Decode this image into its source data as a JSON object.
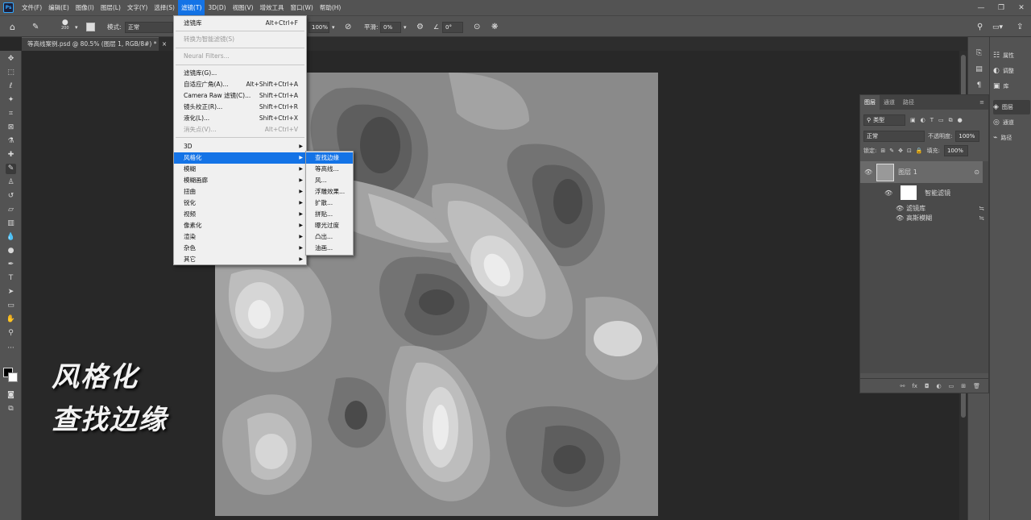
{
  "menubar": {
    "items": [
      "文件(F)",
      "编辑(E)",
      "图像(I)",
      "图层(L)",
      "文字(Y)",
      "选择(S)",
      "滤镜(T)",
      "3D(D)",
      "视图(V)",
      "增效工具",
      "窗口(W)",
      "帮助(H)"
    ],
    "active_index": 6,
    "app_icon": "Ps"
  },
  "options": {
    "brush_size": "200",
    "mode_label": "模式:",
    "mode_value": "正常",
    "opacity_value": "100%",
    "smooth_label": "平滑:",
    "smooth_value": "0%",
    "angle_value": "0°"
  },
  "document": {
    "tab_title": "等高线案例.psd @ 80.5% (图层 1, RGB/8#) *",
    "close_glyph": "×"
  },
  "filter_menu": {
    "items": [
      {
        "label": "滤镜库",
        "shortcut": "Alt+Ctrl+F",
        "disabled": false
      },
      {
        "label": "转换为智能滤镜(S)",
        "shortcut": "",
        "disabled": true
      },
      {
        "label": "Neural Filters...",
        "shortcut": "",
        "disabled": true
      },
      {
        "label": "滤镜库(G)...",
        "shortcut": "",
        "disabled": false
      },
      {
        "label": "自适应广角(A)...",
        "shortcut": "Alt+Shift+Ctrl+A",
        "disabled": false
      },
      {
        "label": "Camera Raw 滤镜(C)...",
        "shortcut": "Shift+Ctrl+A",
        "disabled": false
      },
      {
        "label": "镜头校正(R)...",
        "shortcut": "Shift+Ctrl+R",
        "disabled": false
      },
      {
        "label": "液化(L)...",
        "shortcut": "Shift+Ctrl+X",
        "disabled": false
      },
      {
        "label": "消失点(V)...",
        "shortcut": "Alt+Ctrl+V",
        "disabled": true
      },
      {
        "label": "3D",
        "shortcut": "",
        "disabled": false
      },
      {
        "label": "风格化",
        "shortcut": "",
        "disabled": false
      },
      {
        "label": "模糊",
        "shortcut": "",
        "disabled": false
      },
      {
        "label": "模糊画廊",
        "shortcut": "",
        "disabled": false
      },
      {
        "label": "扭曲",
        "shortcut": "",
        "disabled": false
      },
      {
        "label": "锐化",
        "shortcut": "",
        "disabled": false
      },
      {
        "label": "视频",
        "shortcut": "",
        "disabled": false
      },
      {
        "label": "像素化",
        "shortcut": "",
        "disabled": false
      },
      {
        "label": "渲染",
        "shortcut": "",
        "disabled": false
      },
      {
        "label": "杂色",
        "shortcut": "",
        "disabled": false
      },
      {
        "label": "其它",
        "shortcut": "",
        "disabled": false
      }
    ],
    "highlighted": "风格化"
  },
  "stylize_submenu": {
    "items": [
      "查找边缘",
      "等高线...",
      "风...",
      "浮雕效果...",
      "扩散...",
      "拼贴...",
      "曝光过度",
      "凸出...",
      "油画..."
    ],
    "highlighted": "查找边缘"
  },
  "layers_panel": {
    "tabs": [
      "图层",
      "通道",
      "路径"
    ],
    "filter_label": "类型",
    "blend_mode": "正常",
    "opacity_label": "不透明度:",
    "opacity_value": "100%",
    "lock_label": "锁定:",
    "fill_label": "填充:",
    "fill_value": "100%",
    "layer_name": "图层 1",
    "smart_filters_label": "智能滤镜",
    "filters": [
      "滤镜库",
      "高斯模糊"
    ]
  },
  "right_panels": {
    "items": [
      {
        "icon": "properties-icon",
        "label": "属性"
      },
      {
        "icon": "adjustments-icon",
        "label": "调整"
      },
      {
        "icon": "libraries-icon",
        "label": "库"
      },
      {
        "icon": "layers-icon",
        "label": "图层"
      },
      {
        "icon": "channels-icon",
        "label": "通道"
      },
      {
        "icon": "paths-icon",
        "label": "路径"
      }
    ]
  },
  "captions": {
    "line1": "风格化",
    "line2": "查找边缘"
  },
  "colors": {
    "highlight": "#1473e6",
    "ui_dark": "#535353",
    "canvas_bg": "#282828"
  }
}
